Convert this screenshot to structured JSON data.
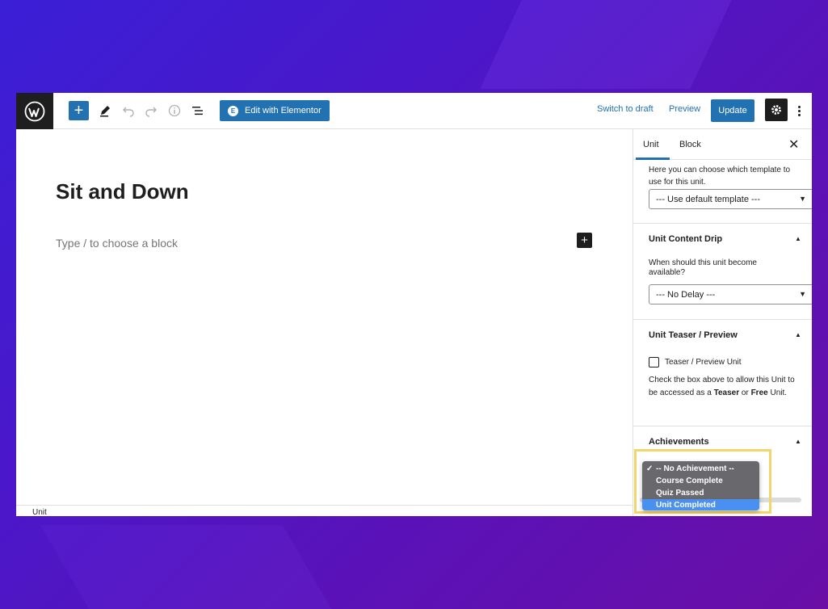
{
  "toolbar": {
    "edit_with_elementor_label": "Edit with Elementor",
    "switch_to_draft_label": "Switch to draft",
    "preview_label": "Preview",
    "update_label": "Update"
  },
  "editor": {
    "post_title": "Sit and Down",
    "block_placeholder": "Type / to choose a block",
    "footer_breadcrumb": "Unit"
  },
  "sidebar": {
    "tabs": [
      {
        "label": "Unit",
        "active": true
      },
      {
        "label": "Block",
        "active": false
      }
    ],
    "template": {
      "description": "Here you can choose which template to use for this unit.",
      "selected": "--- Use default template ---"
    },
    "content_drip": {
      "title": "Unit Content Drip",
      "question": "When should this unit become available?",
      "selected": "--- No Delay ---"
    },
    "teaser": {
      "title": "Unit Teaser / Preview",
      "checkbox_label": "Teaser / Preview Unit",
      "checked": false,
      "help_part1": "Check the box above to allow this Unit to be accessed as a ",
      "help_bold1": "Teaser",
      "help_part2": " or ",
      "help_bold2": "Free",
      "help_part3": " Unit."
    },
    "achievements": {
      "title": "Achievements",
      "options": [
        {
          "label": "-- No Achievement --",
          "checked": true,
          "highlighted": false
        },
        {
          "label": "Course Complete",
          "checked": false,
          "highlighted": false
        },
        {
          "label": "Quiz Passed",
          "checked": false,
          "highlighted": false
        },
        {
          "label": "Unit Completed",
          "checked": false,
          "highlighted": true
        }
      ]
    }
  },
  "colors": {
    "accent": "#2271b1",
    "highlight_frame": "#f3d66b",
    "dropdown_selection": "#4a90f0"
  }
}
